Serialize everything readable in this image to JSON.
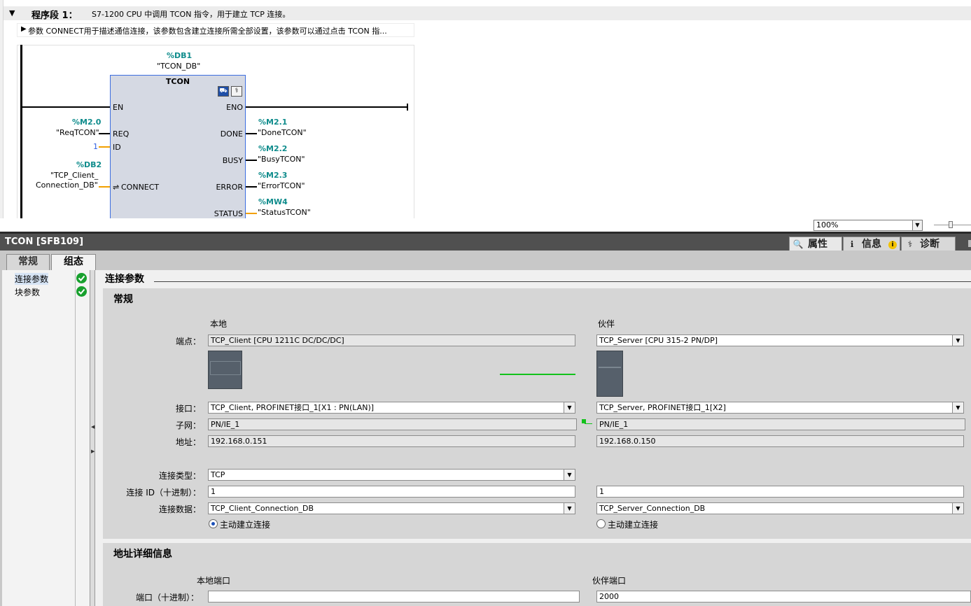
{
  "network": {
    "title": "程序段 1：",
    "description": "S7-1200 CPU 中调用 TCON 指令，用于建立 TCP 连接。",
    "comment": "参数 CONNECT用于描述通信连接，该参数包含建立连接所需全部设置，该参数可以通过点击 TCON 指..."
  },
  "block": {
    "db_address": "%DB1",
    "db_name": "\"TCON_DB\"",
    "type": "TCON",
    "pins": {
      "en": "EN",
      "req": "REQ",
      "id": "ID",
      "connect": "CONNECT",
      "eno": "ENO",
      "done": "DONE",
      "busy": "BUSY",
      "error": "ERROR",
      "status": "STATUS"
    },
    "operands": {
      "req_addr": "%M2.0",
      "req_name": "\"ReqTCON\"",
      "id_value": "1",
      "connect_addr": "%DB2",
      "connect_name1": "\"TCP_Client_",
      "connect_name2": "Connection_DB\"",
      "done_addr": "%M2.1",
      "done_name": "\"DoneTCON\"",
      "busy_addr": "%M2.2",
      "busy_name": "\"BusyTCON\"",
      "error_addr": "%M2.3",
      "error_name": "\"ErrorTCON\"",
      "status_addr": "%MW4",
      "status_name": "\"StatusTCON\""
    }
  },
  "zoom": {
    "value": "100%"
  },
  "inspector": {
    "title": "TCON [SFB109]",
    "right_tabs": [
      "属性",
      "信息",
      "诊断"
    ],
    "tabs": [
      "常规",
      "组态"
    ],
    "nav": [
      "连接参数",
      "块参数"
    ],
    "section_title": "连接参数"
  },
  "general": {
    "title": "常规",
    "local_header": "本地",
    "partner_header": "伙伴",
    "labels": {
      "endpoint": "端点：",
      "interface": "接口：",
      "subnet": "子网：",
      "address": "地址：",
      "conn_type": "连接类型：",
      "conn_id": "连接 ID（十进制）：",
      "conn_data": "连接数据："
    },
    "local": {
      "endpoint": "TCP_Client [CPU 1211C DC/DC/DC]",
      "interface": "TCP_Client, PROFINET接口_1[X1 : PN(LAN)]",
      "subnet": "PN/IE_1",
      "address": "192.168.0.151",
      "conn_type": "TCP",
      "conn_id": "1",
      "conn_data": "TCP_Client_Connection_DB",
      "active": "主动建立连接"
    },
    "partner": {
      "endpoint": "TCP_Server [CPU 315-2 PN/DP]",
      "interface": "TCP_Server, PROFINET接口_1[X2]",
      "subnet": "PN/IE_1",
      "address": "192.168.0.150",
      "conn_id": "1",
      "conn_data": "TCP_Server_Connection_DB",
      "active": "主动建立连接"
    }
  },
  "address_details": {
    "title": "地址详细信息",
    "local_port_header": "本地端口",
    "partner_port_header": "伙伴端口",
    "port_label": "端口（十进制）：",
    "local_port": "",
    "partner_port": "2000"
  },
  "colors": {
    "check": "#17a02d",
    "link": "#13c21b",
    "accent": "#0f8c8c"
  }
}
